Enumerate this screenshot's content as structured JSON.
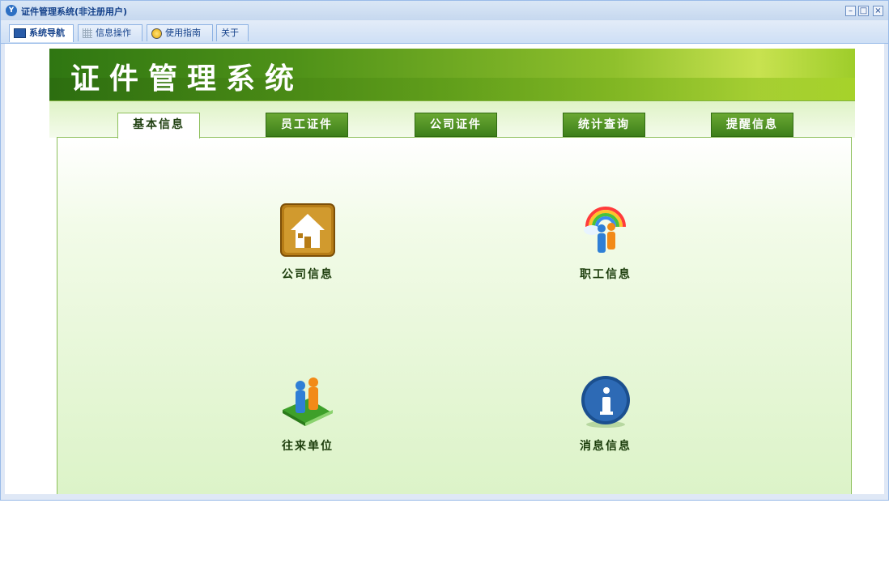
{
  "window": {
    "title": "证件管理系统(非注册用户)",
    "controls": [
      "–",
      "□",
      "×"
    ]
  },
  "window_tabs": [
    {
      "label": "系统导航",
      "icon": "monitor-icon",
      "active": true
    },
    {
      "label": "信息操作",
      "icon": "grid-icon",
      "active": false
    },
    {
      "label": "使用指南",
      "icon": "help-circle-icon",
      "active": false
    },
    {
      "label": "关于",
      "icon": "",
      "active": false
    }
  ],
  "banner": {
    "title": "证件管理系统"
  },
  "main_tabs": [
    {
      "label": "基本信息",
      "active": true
    },
    {
      "label": "员工证件",
      "active": false
    },
    {
      "label": "公司证件",
      "active": false
    },
    {
      "label": "统计查询",
      "active": false
    },
    {
      "label": "提醒信息",
      "active": false
    }
  ],
  "items": [
    {
      "label": "公司信息",
      "icon": "house-icon"
    },
    {
      "label": "职工信息",
      "icon": "people-rainbow-icon"
    },
    {
      "label": "往来单位",
      "icon": "people-book-icon"
    },
    {
      "label": "消息信息",
      "icon": "info-icon"
    }
  ],
  "colors": {
    "accent": "#3d7f1a",
    "header_blue": "#15428b"
  }
}
